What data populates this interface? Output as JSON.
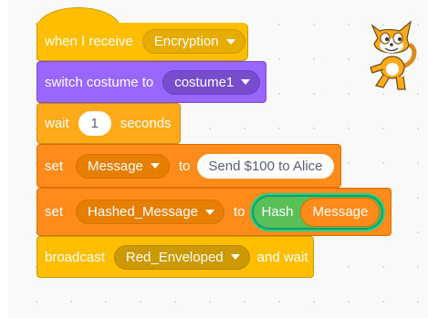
{
  "blocks": {
    "when_receive": {
      "label": "when I receive",
      "message": "Encryption"
    },
    "switch_costume": {
      "label": "switch costume to",
      "costume": "costume1"
    },
    "wait": {
      "label": "wait",
      "value": "1",
      "unit": "seconds"
    },
    "set_message": {
      "label": "set",
      "variable": "Message",
      "to": "to",
      "value": "Send $100 to Alice"
    },
    "set_hashed": {
      "label": "set",
      "variable": "Hashed_Message",
      "to": "to",
      "op": "Hash",
      "op_input": "Message"
    },
    "broadcast": {
      "label": "broadcast",
      "message": "Red_Enveloped",
      "suffix": "and wait"
    }
  },
  "sprite": {
    "icon": "cat-sprite-icon"
  },
  "colors": {
    "events": "#ffbf00",
    "looks": "#9966ff",
    "control": "#ffab19",
    "variables": "#ff8c1a",
    "operators": "#59c059",
    "canvas": "#f9f9f9"
  }
}
